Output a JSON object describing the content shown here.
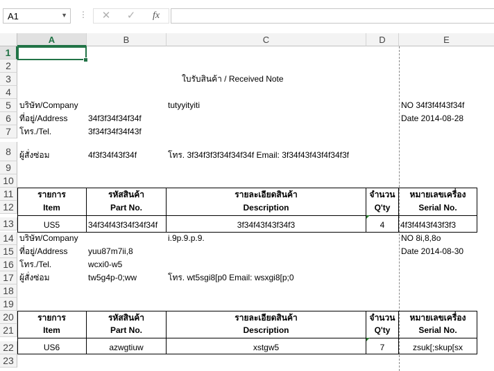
{
  "toolbar": {
    "name_box": "A1",
    "cancel_icon": "✕",
    "enter_icon": "✓",
    "fx_label": "fx",
    "formula_value": ""
  },
  "columns": [
    "A",
    "B",
    "C",
    "D",
    "E"
  ],
  "rows": [
    "1",
    "2",
    "3",
    "4",
    "5",
    "6",
    "7",
    "8",
    "9",
    "10",
    "11",
    "12",
    "13",
    "14",
    "15",
    "16",
    "17",
    "18",
    "19",
    "20",
    "21",
    "22",
    "23"
  ],
  "sheet": {
    "title": "ใบรับสินค้า / Received Note",
    "record1": {
      "company_label": "บริษัท/Company",
      "company_value": "tutyyityiti",
      "no": "NO 34f3f4f43f34f",
      "address_label": "ที่อยู่/Address",
      "address_value": "34f3f34f34f34f",
      "date": "Date 2014-08-28",
      "tel_label": "โทร./Tel.",
      "tel_value": "3f34f34f34f43f",
      "orderer_label": "ผู้สั่งซ่อม",
      "orderer_value": "4f3f34f43f34f",
      "orderer_contact": "โทร. 3f34f3f3f34f34f34f Email: 3f34f43f43f4f34f3f",
      "header_th": [
        "รายการ",
        "รหัสสินค้า",
        "รายละเอียดสินค้า",
        "จำนวน",
        "หมายเลขเครื่อง"
      ],
      "header_en": [
        "Item",
        "Part No.",
        "Description",
        "Q'ty",
        "Serial No."
      ],
      "row": [
        "US5",
        "34f34f43f34f34f34f",
        "3f34f43f43f34f3",
        "4",
        "4f3f4f43f43f3f3"
      ]
    },
    "record2": {
      "company_label": "บริษัท/Company",
      "company_value": "i.9p.9.p.9.",
      "no": "NO 8i,8,8o",
      "address_label": "ที่อยู่/Address",
      "address_value": "yuu87m7ii,8",
      "date": "Date 2014-08-30",
      "tel_label": "โทร./Tel.",
      "tel_value": "wcxi0-w5",
      "orderer_label": "ผู้สั่งซ่อม",
      "orderer_value": "tw5g4p-0;ww",
      "orderer_contact": "โทร. wt5sgi8[p0 Email: wsxgi8[p;0",
      "header_th": [
        "รายการ",
        "รหัสสินค้า",
        "รายละเอียดสินค้า",
        "จำนวน",
        "หมายเลขเครื่อง"
      ],
      "header_en": [
        "Item",
        "Part No.",
        "Description",
        "Q'ty",
        "Serial No."
      ],
      "row": [
        "US6",
        "azwgtiuw",
        "xstgw5",
        "7",
        "zsuk[;skup[sx"
      ]
    }
  }
}
